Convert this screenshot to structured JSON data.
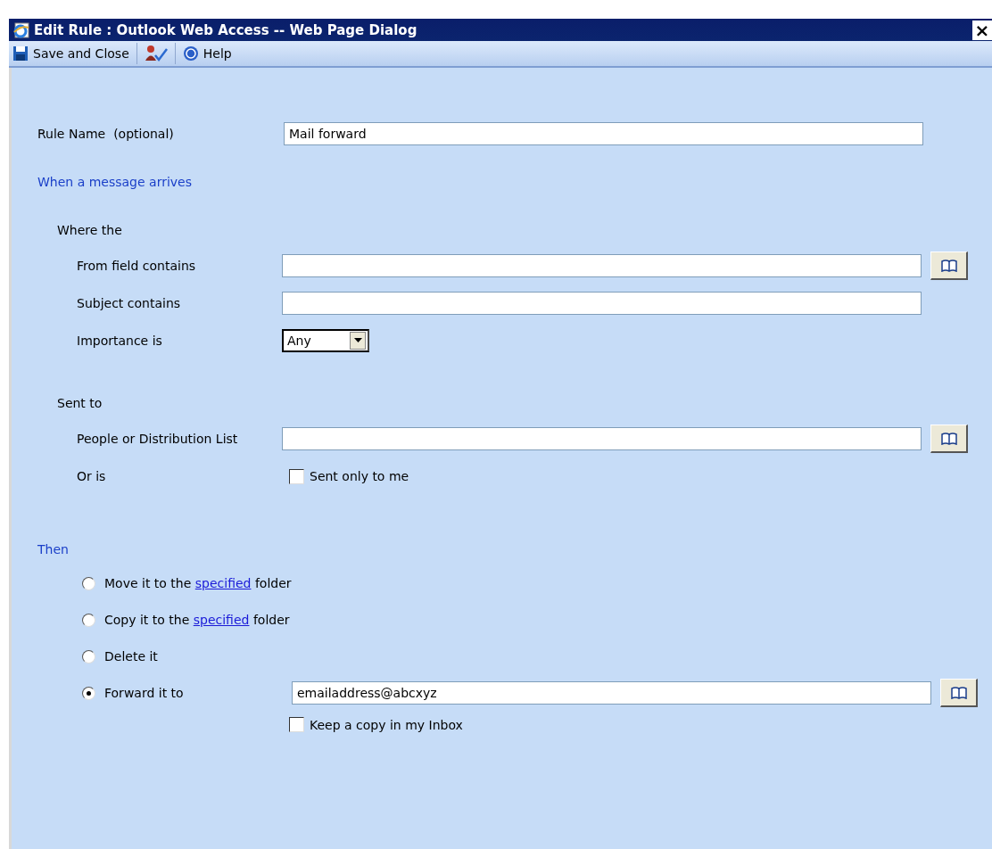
{
  "window": {
    "title": "Edit Rule : Outlook Web Access -- Web Page Dialog",
    "close": "×"
  },
  "toolbar": [
    {
      "kind": "save",
      "label": "Save and Close"
    },
    {
      "kind": "check-names"
    },
    {
      "kind": "help",
      "label": "Help"
    }
  ],
  "rule_name": {
    "label": "Rule Name  (optional)",
    "value": "Mail forward"
  },
  "when": {
    "heading": "When a message arrives",
    "groups": [
      {
        "heading": "Where the",
        "rows": [
          {
            "kind": "text",
            "label": "From field contains",
            "value": "",
            "address_book": true
          },
          {
            "kind": "text",
            "label": "Subject contains",
            "value": "",
            "address_book": false
          },
          {
            "kind": "select",
            "label": "Importance is",
            "value": "Any"
          }
        ]
      },
      {
        "heading": "Sent to",
        "rows": [
          {
            "kind": "text",
            "label": "People or Distribution List",
            "value": "",
            "address_book": true
          },
          {
            "kind": "checkbox",
            "label": "Or is",
            "option": "Sent only to me",
            "checked": false
          }
        ]
      }
    ]
  },
  "then": {
    "heading": "Then",
    "actions": [
      {
        "kind": "link",
        "before": "Move it to the ",
        "link": "specified",
        "after": " folder",
        "selected": false
      },
      {
        "kind": "link",
        "before": "Copy it to the ",
        "link": "specified",
        "after": " folder",
        "selected": false
      },
      {
        "kind": "plain",
        "label": "Delete it",
        "selected": false
      },
      {
        "kind": "forward",
        "label": "Forward it to",
        "value": "emailaddress@abcxyz",
        "address_book": true,
        "selected": true
      }
    ],
    "keep_copy": {
      "label": "Keep a copy in my Inbox",
      "checked": false
    }
  }
}
